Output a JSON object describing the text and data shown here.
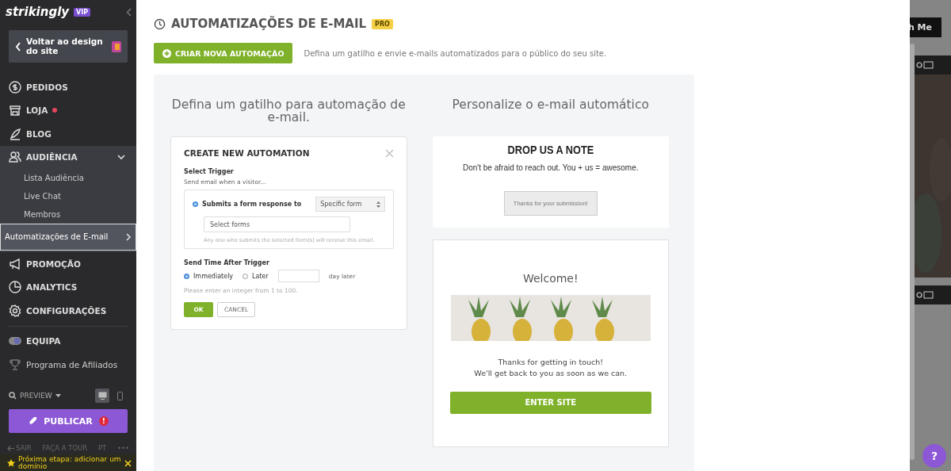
{
  "sidebar": {
    "logo": "strikingly",
    "plan_badge": "VIP",
    "back_button": "Voltar ao design do site",
    "nav": [
      {
        "label": "PEDIDOS",
        "kind": "main"
      },
      {
        "label": "LOJA",
        "kind": "main",
        "notification": true
      },
      {
        "label": "BLOG",
        "kind": "main"
      },
      {
        "label": "AUDIÊNCIA",
        "kind": "main",
        "expanded": true,
        "children": [
          {
            "label": "Lista Audiência",
            "selected": false
          },
          {
            "label": "Live Chat",
            "selected": false
          },
          {
            "label": "Membros",
            "selected": false
          },
          {
            "label": "Automatizações de E-mail",
            "selected": true
          }
        ]
      },
      {
        "label": "PROMOÇÃO",
        "kind": "main"
      },
      {
        "label": "ANALYTICS",
        "kind": "main"
      },
      {
        "label": "CONFIGURAÇÕES",
        "kind": "main"
      },
      {
        "label": "EQUIPA",
        "kind": "team"
      },
      {
        "label": "Programa de Afiliados",
        "kind": "plain"
      }
    ],
    "preview": "PREVIEW",
    "devices": [
      {
        "selected": true
      },
      {
        "selected": false
      }
    ],
    "publish_button": "PUBLICAR",
    "publish_alert": "!",
    "footer_links": [
      "SAIR",
      "FAÇA A TOUR",
      "PT",
      "•••"
    ],
    "next_step": "Próxima etapa: adicionar um domínio"
  },
  "main": {
    "title": "AUTOMATIZAÇÕES DE E-MAIL",
    "title_badge": "PRO",
    "create_button": "CRIAR NOVA AUTOMAÇÃO",
    "description": "Defina um gatilho e envie e-mails automatizados para o público do seu site.",
    "trigger_heading": "Defina um gatilho para automação de e-mail.",
    "email_heading": "Personalize o e-mail automático",
    "dialog": {
      "title": "CREATE NEW AUTOMATION",
      "trigger_label": "Select Trigger",
      "trigger_hint": "Send email when a visitor...",
      "trigger_option": {
        "label": "Submits a form response to",
        "selected": true
      },
      "form_select": "Specific form",
      "forms_placeholder": "Select forms",
      "forms_hint": "Any one who submits the selected form(s) will receive this email.",
      "time_label": "Send Time After Trigger",
      "time_options": [
        {
          "label": "Immediately",
          "selected": true
        },
        {
          "label": "Later",
          "selected": false
        }
      ],
      "days_suffix": "day later",
      "days_hint": "Please enter an integer  from 1 to 100.",
      "ok_button": "OK",
      "cancel_button": "CANCEL"
    },
    "note_card": {
      "title": "DROP US A NOTE",
      "text": "Don't be afraid to reach out. You + us = awesome.",
      "button": "Thanks for your submission!"
    },
    "welcome_card": {
      "title": "Welcome!",
      "lines": [
        "Thanks for getting in touch!",
        "We'll get back to you as soon as we can."
      ],
      "button": "ENTER SITE"
    }
  },
  "background_site": {
    "button": "h Me"
  },
  "help_button": "?"
}
